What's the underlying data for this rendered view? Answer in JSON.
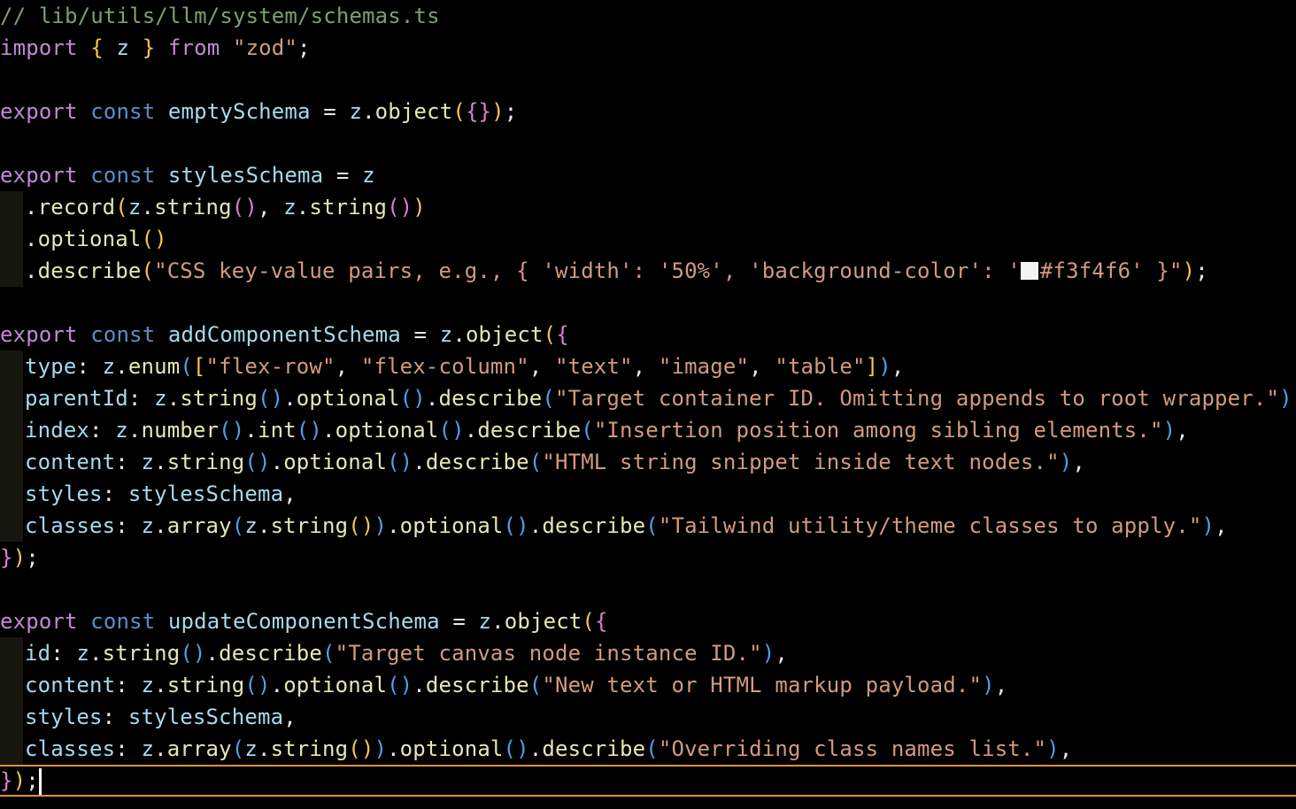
{
  "editor": {
    "file_comment": "// lib/utils/llm/system/schemas.ts",
    "theme_colors": {
      "background": "#000000",
      "comment": "#7f9f6f",
      "keyword": "#c587d6",
      "declaration": "#5b8ec9",
      "identifier": "#a8d8ec",
      "string": "#d29a7f",
      "bracket_level1": "#f5c84a",
      "bracket_level2": "#d684ca",
      "bracket_level3": "#4ea1e8",
      "current_line_border": "#e0913a",
      "swatch_color": "#f3f4f6"
    },
    "lines": [
      [
        {
          "t": "// lib/utils/llm/system/schemas.ts",
          "c": "comment"
        }
      ],
      [
        {
          "t": "import",
          "c": "kw"
        },
        {
          "t": " ",
          "c": "plain"
        },
        {
          "t": "{",
          "c": "b1"
        },
        {
          "t": " z ",
          "c": "id"
        },
        {
          "t": "}",
          "c": "b1"
        },
        {
          "t": " ",
          "c": "plain"
        },
        {
          "t": "from",
          "c": "kw"
        },
        {
          "t": " ",
          "c": "plain"
        },
        {
          "t": "\"zod\"",
          "c": "str"
        },
        {
          "t": ";",
          "c": "plain"
        }
      ],
      [],
      [
        {
          "t": "export",
          "c": "kw"
        },
        {
          "t": " ",
          "c": "plain"
        },
        {
          "t": "const",
          "c": "decl"
        },
        {
          "t": " ",
          "c": "plain"
        },
        {
          "t": "emptySchema",
          "c": "id"
        },
        {
          "t": " = ",
          "c": "plain"
        },
        {
          "t": "z",
          "c": "id"
        },
        {
          "t": ".",
          "c": "plain"
        },
        {
          "t": "object",
          "c": "fn"
        },
        {
          "t": "(",
          "c": "b1"
        },
        {
          "t": "{}",
          "c": "b2"
        },
        {
          "t": ")",
          "c": "b1"
        },
        {
          "t": ";",
          "c": "plain"
        }
      ],
      [],
      [
        {
          "t": "export",
          "c": "kw"
        },
        {
          "t": " ",
          "c": "plain"
        },
        {
          "t": "const",
          "c": "decl"
        },
        {
          "t": " ",
          "c": "plain"
        },
        {
          "t": "stylesSchema",
          "c": "id"
        },
        {
          "t": " = ",
          "c": "plain"
        },
        {
          "t": "z",
          "c": "id"
        }
      ],
      {
        "indent": true,
        "tokens": [
          {
            "t": ".",
            "c": "plain"
          },
          {
            "t": "record",
            "c": "fn"
          },
          {
            "t": "(",
            "c": "b1"
          },
          {
            "t": "z",
            "c": "id"
          },
          {
            "t": ".",
            "c": "plain"
          },
          {
            "t": "string",
            "c": "fn"
          },
          {
            "t": "()",
            "c": "b2"
          },
          {
            "t": ", ",
            "c": "plain"
          },
          {
            "t": "z",
            "c": "id"
          },
          {
            "t": ".",
            "c": "plain"
          },
          {
            "t": "string",
            "c": "fn"
          },
          {
            "t": "()",
            "c": "b2"
          },
          {
            "t": ")",
            "c": "b1"
          }
        ]
      },
      {
        "indent": true,
        "tokens": [
          {
            "t": ".",
            "c": "plain"
          },
          {
            "t": "optional",
            "c": "fn"
          },
          {
            "t": "()",
            "c": "b1"
          }
        ]
      },
      {
        "indent": true,
        "tokens": [
          {
            "t": ".",
            "c": "plain"
          },
          {
            "t": "describe",
            "c": "fn"
          },
          {
            "t": "(",
            "c": "b1"
          },
          {
            "t": "\"CSS key-value pairs, e.g., { 'width': '50%', 'background-color': '",
            "c": "str"
          },
          {
            "t": "",
            "c": "swatch"
          },
          {
            "t": "#f3f4f6' }\"",
            "c": "str"
          },
          {
            "t": ")",
            "c": "b1"
          },
          {
            "t": ";",
            "c": "plain"
          }
        ]
      },
      [],
      [
        {
          "t": "export",
          "c": "kw"
        },
        {
          "t": " ",
          "c": "plain"
        },
        {
          "t": "const",
          "c": "decl"
        },
        {
          "t": " ",
          "c": "plain"
        },
        {
          "t": "addComponentSchema",
          "c": "id"
        },
        {
          "t": " = ",
          "c": "plain"
        },
        {
          "t": "z",
          "c": "id"
        },
        {
          "t": ".",
          "c": "plain"
        },
        {
          "t": "object",
          "c": "fn"
        },
        {
          "t": "(",
          "c": "b1"
        },
        {
          "t": "{",
          "c": "b2"
        }
      ],
      {
        "indent": true,
        "tokens": [
          {
            "t": "type",
            "c": "id"
          },
          {
            "t": ": ",
            "c": "plain"
          },
          {
            "t": "z",
            "c": "id"
          },
          {
            "t": ".",
            "c": "plain"
          },
          {
            "t": "enum",
            "c": "fn"
          },
          {
            "t": "(",
            "c": "b3"
          },
          {
            "t": "[",
            "c": "b1"
          },
          {
            "t": "\"flex-row\"",
            "c": "str"
          },
          {
            "t": ", ",
            "c": "plain"
          },
          {
            "t": "\"flex-column\"",
            "c": "str"
          },
          {
            "t": ", ",
            "c": "plain"
          },
          {
            "t": "\"text\"",
            "c": "str"
          },
          {
            "t": ", ",
            "c": "plain"
          },
          {
            "t": "\"image\"",
            "c": "str"
          },
          {
            "t": ", ",
            "c": "plain"
          },
          {
            "t": "\"table\"",
            "c": "str"
          },
          {
            "t": "]",
            "c": "b1"
          },
          {
            "t": ")",
            "c": "b3"
          },
          {
            "t": ",",
            "c": "plain"
          }
        ]
      },
      {
        "indent": true,
        "tokens": [
          {
            "t": "parentId",
            "c": "id"
          },
          {
            "t": ": ",
            "c": "plain"
          },
          {
            "t": "z",
            "c": "id"
          },
          {
            "t": ".",
            "c": "plain"
          },
          {
            "t": "string",
            "c": "fn"
          },
          {
            "t": "()",
            "c": "b3"
          },
          {
            "t": ".",
            "c": "plain"
          },
          {
            "t": "optional",
            "c": "fn"
          },
          {
            "t": "()",
            "c": "b3"
          },
          {
            "t": ".",
            "c": "plain"
          },
          {
            "t": "describe",
            "c": "fn"
          },
          {
            "t": "(",
            "c": "b3"
          },
          {
            "t": "\"Target container ID. Omitting appends to root wrapper.\"",
            "c": "str"
          },
          {
            "t": ")",
            "c": "b3"
          },
          {
            "t": ",",
            "c": "plain"
          }
        ]
      },
      {
        "indent": true,
        "tokens": [
          {
            "t": "index",
            "c": "id"
          },
          {
            "t": ": ",
            "c": "plain"
          },
          {
            "t": "z",
            "c": "id"
          },
          {
            "t": ".",
            "c": "plain"
          },
          {
            "t": "number",
            "c": "fn"
          },
          {
            "t": "()",
            "c": "b3"
          },
          {
            "t": ".",
            "c": "plain"
          },
          {
            "t": "int",
            "c": "fn"
          },
          {
            "t": "()",
            "c": "b3"
          },
          {
            "t": ".",
            "c": "plain"
          },
          {
            "t": "optional",
            "c": "fn"
          },
          {
            "t": "()",
            "c": "b3"
          },
          {
            "t": ".",
            "c": "plain"
          },
          {
            "t": "describe",
            "c": "fn"
          },
          {
            "t": "(",
            "c": "b3"
          },
          {
            "t": "\"Insertion position among sibling elements.\"",
            "c": "str"
          },
          {
            "t": ")",
            "c": "b3"
          },
          {
            "t": ",",
            "c": "plain"
          }
        ]
      },
      {
        "indent": true,
        "tokens": [
          {
            "t": "content",
            "c": "id"
          },
          {
            "t": ": ",
            "c": "plain"
          },
          {
            "t": "z",
            "c": "id"
          },
          {
            "t": ".",
            "c": "plain"
          },
          {
            "t": "string",
            "c": "fn"
          },
          {
            "t": "()",
            "c": "b3"
          },
          {
            "t": ".",
            "c": "plain"
          },
          {
            "t": "optional",
            "c": "fn"
          },
          {
            "t": "()",
            "c": "b3"
          },
          {
            "t": ".",
            "c": "plain"
          },
          {
            "t": "describe",
            "c": "fn"
          },
          {
            "t": "(",
            "c": "b3"
          },
          {
            "t": "\"HTML string snippet inside text nodes.\"",
            "c": "str"
          },
          {
            "t": ")",
            "c": "b3"
          },
          {
            "t": ",",
            "c": "plain"
          }
        ]
      },
      {
        "indent": true,
        "tokens": [
          {
            "t": "styles",
            "c": "id"
          },
          {
            "t": ": ",
            "c": "plain"
          },
          {
            "t": "stylesSchema",
            "c": "id"
          },
          {
            "t": ",",
            "c": "plain"
          }
        ]
      },
      {
        "indent": true,
        "tokens": [
          {
            "t": "classes",
            "c": "id"
          },
          {
            "t": ": ",
            "c": "plain"
          },
          {
            "t": "z",
            "c": "id"
          },
          {
            "t": ".",
            "c": "plain"
          },
          {
            "t": "array",
            "c": "fn"
          },
          {
            "t": "(",
            "c": "b3"
          },
          {
            "t": "z",
            "c": "id"
          },
          {
            "t": ".",
            "c": "plain"
          },
          {
            "t": "string",
            "c": "fn"
          },
          {
            "t": "()",
            "c": "b1"
          },
          {
            "t": ")",
            "c": "b3"
          },
          {
            "t": ".",
            "c": "plain"
          },
          {
            "t": "optional",
            "c": "fn"
          },
          {
            "t": "()",
            "c": "b3"
          },
          {
            "t": ".",
            "c": "plain"
          },
          {
            "t": "describe",
            "c": "fn"
          },
          {
            "t": "(",
            "c": "b3"
          },
          {
            "t": "\"Tailwind utility/theme classes to apply.\"",
            "c": "str"
          },
          {
            "t": ")",
            "c": "b3"
          },
          {
            "t": ",",
            "c": "plain"
          }
        ]
      },
      [
        {
          "t": "}",
          "c": "b2"
        },
        {
          "t": ")",
          "c": "b1"
        },
        {
          "t": ";",
          "c": "plain"
        }
      ],
      [],
      [
        {
          "t": "export",
          "c": "kw"
        },
        {
          "t": " ",
          "c": "plain"
        },
        {
          "t": "const",
          "c": "decl"
        },
        {
          "t": " ",
          "c": "plain"
        },
        {
          "t": "updateComponentSchema",
          "c": "id"
        },
        {
          "t": " = ",
          "c": "plain"
        },
        {
          "t": "z",
          "c": "id"
        },
        {
          "t": ".",
          "c": "plain"
        },
        {
          "t": "object",
          "c": "fn"
        },
        {
          "t": "(",
          "c": "b1"
        },
        {
          "t": "{",
          "c": "b2"
        }
      ],
      {
        "indent": true,
        "tokens": [
          {
            "t": "id",
            "c": "id"
          },
          {
            "t": ": ",
            "c": "plain"
          },
          {
            "t": "z",
            "c": "id"
          },
          {
            "t": ".",
            "c": "plain"
          },
          {
            "t": "string",
            "c": "fn"
          },
          {
            "t": "()",
            "c": "b3"
          },
          {
            "t": ".",
            "c": "plain"
          },
          {
            "t": "describe",
            "c": "fn"
          },
          {
            "t": "(",
            "c": "b3"
          },
          {
            "t": "\"Target canvas node instance ID.\"",
            "c": "str"
          },
          {
            "t": ")",
            "c": "b3"
          },
          {
            "t": ",",
            "c": "plain"
          }
        ]
      },
      {
        "indent": true,
        "tokens": [
          {
            "t": "content",
            "c": "id"
          },
          {
            "t": ": ",
            "c": "plain"
          },
          {
            "t": "z",
            "c": "id"
          },
          {
            "t": ".",
            "c": "plain"
          },
          {
            "t": "string",
            "c": "fn"
          },
          {
            "t": "()",
            "c": "b3"
          },
          {
            "t": ".",
            "c": "plain"
          },
          {
            "t": "optional",
            "c": "fn"
          },
          {
            "t": "()",
            "c": "b3"
          },
          {
            "t": ".",
            "c": "plain"
          },
          {
            "t": "describe",
            "c": "fn"
          },
          {
            "t": "(",
            "c": "b3"
          },
          {
            "t": "\"New text or HTML markup payload.\"",
            "c": "str"
          },
          {
            "t": ")",
            "c": "b3"
          },
          {
            "t": ",",
            "c": "plain"
          }
        ]
      },
      {
        "indent": true,
        "tokens": [
          {
            "t": "styles",
            "c": "id"
          },
          {
            "t": ": ",
            "c": "plain"
          },
          {
            "t": "stylesSchema",
            "c": "id"
          },
          {
            "t": ",",
            "c": "plain"
          }
        ]
      },
      {
        "indent": true,
        "tokens": [
          {
            "t": "classes",
            "c": "id"
          },
          {
            "t": ": ",
            "c": "plain"
          },
          {
            "t": "z",
            "c": "id"
          },
          {
            "t": ".",
            "c": "plain"
          },
          {
            "t": "array",
            "c": "fn"
          },
          {
            "t": "(",
            "c": "b3"
          },
          {
            "t": "z",
            "c": "id"
          },
          {
            "t": ".",
            "c": "plain"
          },
          {
            "t": "string",
            "c": "fn"
          },
          {
            "t": "()",
            "c": "b1"
          },
          {
            "t": ")",
            "c": "b3"
          },
          {
            "t": ".",
            "c": "plain"
          },
          {
            "t": "optional",
            "c": "fn"
          },
          {
            "t": "()",
            "c": "b3"
          },
          {
            "t": ".",
            "c": "plain"
          },
          {
            "t": "describe",
            "c": "fn"
          },
          {
            "t": "(",
            "c": "b3"
          },
          {
            "t": "\"Overriding class names list.\"",
            "c": "str"
          },
          {
            "t": ")",
            "c": "b3"
          },
          {
            "t": ",",
            "c": "plain"
          }
        ]
      },
      {
        "current": true,
        "tokens": [
          {
            "t": "}",
            "c": "b2"
          },
          {
            "t": ")",
            "c": "b1"
          },
          {
            "t": ";",
            "c": "plain"
          }
        ]
      }
    ]
  }
}
